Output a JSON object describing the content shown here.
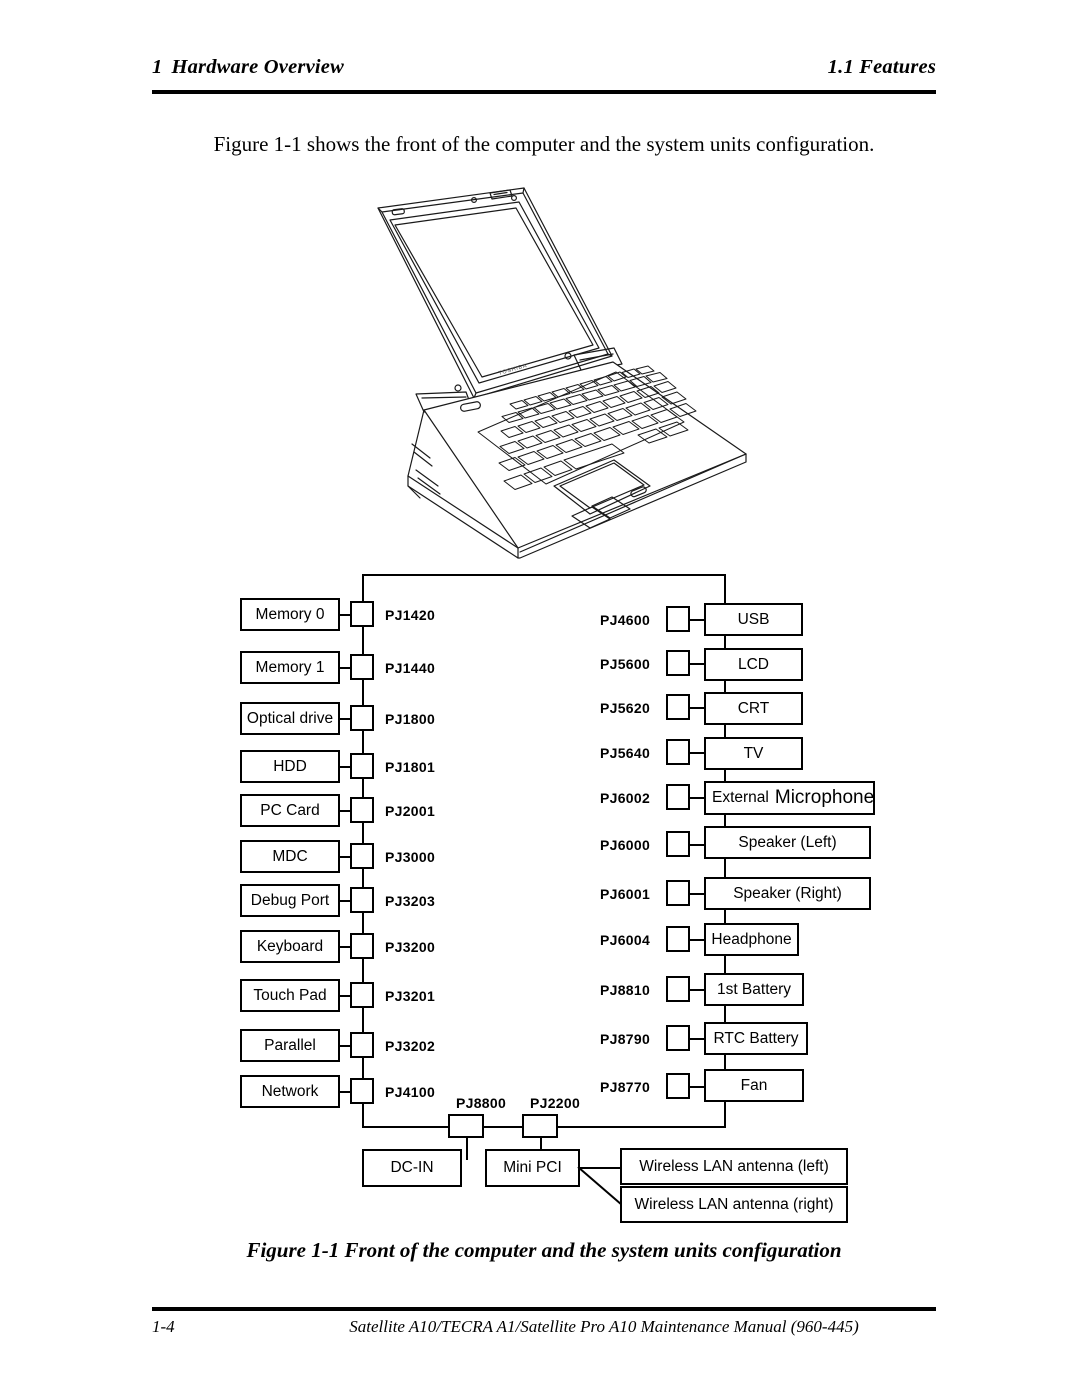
{
  "header": {
    "section_number": "1",
    "section_title": "Hardware Overview",
    "subsection": "1.1  Features"
  },
  "intro": {
    "text": "Figure 1-1 shows the front of the computer and the system units configuration."
  },
  "illustration": {
    "name": "laptop-line-drawing",
    "brand_logo": "TOSHIBA"
  },
  "caption": {
    "text": "Figure 1-1 Front of the computer and the system units configuration"
  },
  "footer": {
    "page_number": "1-4",
    "manual_title": "Satellite A10/TECRA A1/Satellite Pro A10  Maintenance Manual (960-445)"
  },
  "diagram": {
    "board_label": "system-board",
    "left_components": [
      {
        "label": "Memory 0",
        "connector": "PJ1420"
      },
      {
        "label": "Memory 1",
        "connector": "PJ1440"
      },
      {
        "label": "Optical drive",
        "connector": "PJ1800"
      },
      {
        "label": "HDD",
        "connector": "PJ1801"
      },
      {
        "label": "PC Card",
        "connector": "PJ2001"
      },
      {
        "label": "MDC",
        "connector": "PJ3000"
      },
      {
        "label": "Debug Port",
        "connector": "PJ3203"
      },
      {
        "label": "Keyboard",
        "connector": "PJ3200"
      },
      {
        "label": "Touch Pad",
        "connector": "PJ3201"
      },
      {
        "label": "Parallel",
        "connector": "PJ3202"
      },
      {
        "label": "Network",
        "connector": "PJ4100"
      }
    ],
    "right_components": [
      {
        "label": "USB",
        "connector": "PJ4600"
      },
      {
        "label": "LCD",
        "connector": "PJ5600"
      },
      {
        "label": "CRT",
        "connector": "PJ5620"
      },
      {
        "label": "TV",
        "connector": "PJ5640"
      },
      {
        "label": "External Microphone",
        "label_part1": "External",
        "label_part2": "Microphone",
        "connector": "PJ6002"
      },
      {
        "label": "Speaker (Left)",
        "connector": "PJ6000"
      },
      {
        "label": "Speaker (Right)",
        "connector": "PJ6001"
      },
      {
        "label": "Headphone",
        "connector": "PJ6004"
      },
      {
        "label": "1st Battery",
        "connector": "PJ8810"
      },
      {
        "label": "RTC Battery",
        "connector": "PJ8790"
      },
      {
        "label": "Fan",
        "connector": "PJ8770"
      }
    ],
    "bottom_components": [
      {
        "label": "DC-IN",
        "connector": "PJ8800"
      },
      {
        "label": "Mini PCI",
        "connector": "PJ2200"
      }
    ],
    "antennas": [
      {
        "label": "Wireless LAN antenna (left)"
      },
      {
        "label": "Wireless LAN antenna (right)"
      }
    ]
  }
}
